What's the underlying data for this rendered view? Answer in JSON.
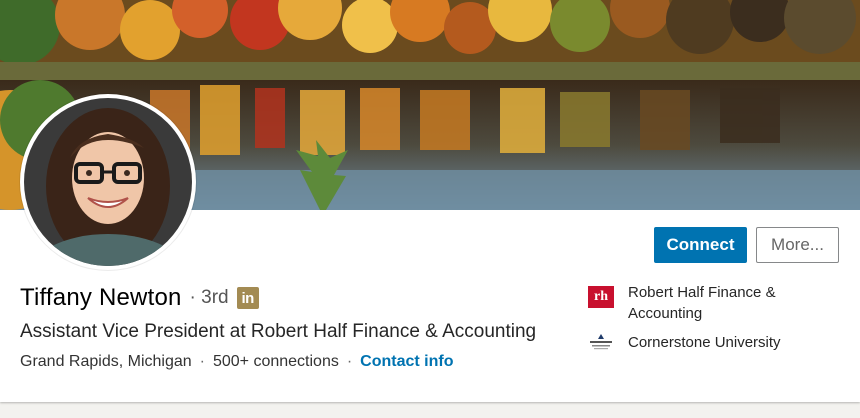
{
  "profile": {
    "name": "Tiffany Newton",
    "degree": "· 3rd",
    "badge": "in",
    "headline": "Assistant Vice President at Robert Half Finance & Accounting",
    "location": "Grand Rapids, Michigan",
    "connections": "500+ connections",
    "contact_label": "Contact info",
    "separator": "·"
  },
  "actions": {
    "connect_label": "Connect",
    "more_label": "More..."
  },
  "side": {
    "company": "Robert Half Finance & Accounting",
    "company_logo_text": "rh",
    "company_logo_icon": "robert-half-logo",
    "school": "Cornerstone University",
    "school_logo_icon": "cornerstone-logo"
  },
  "colors": {
    "primary": "#0073b1",
    "badge": "#a38b53",
    "rh_red": "#c8102e"
  }
}
